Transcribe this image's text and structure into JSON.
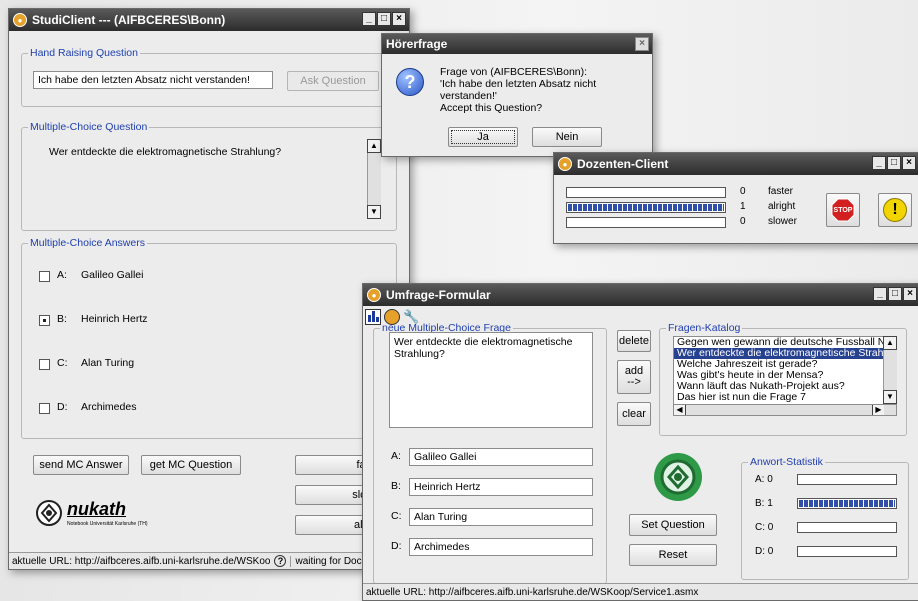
{
  "student": {
    "title": "StudiClient --- (AIFBCERES\\Bonn)",
    "hand_raising": {
      "legend": "Hand Raising Question",
      "question_value": "Ich habe den letzten Absatz nicht verstanden!",
      "ask_button": "Ask Question"
    },
    "mc_question": {
      "legend": "Multiple-Choice Question",
      "text": "Wer entdeckte die elektromagnetische Strahlung?"
    },
    "mc_answers": {
      "legend": "Multiple-Choice Answers",
      "items": [
        {
          "letter": "A:",
          "label": "Galileo Gallei",
          "checked": false
        },
        {
          "letter": "B:",
          "label": "Heinrich Hertz",
          "checked": true
        },
        {
          "letter": "C:",
          "label": "Alan Turing",
          "checked": false
        },
        {
          "letter": "D:",
          "label": "Archimedes",
          "checked": false
        }
      ]
    },
    "buttons": {
      "send": "send MC Answer",
      "get": "get MC Question",
      "faster": "faster",
      "slower": "slower",
      "alright": "alright"
    },
    "logo_text": "nukath",
    "logo_sub": "Notebook Universität Karlsruhe (TH)",
    "status_url": "aktuelle URL: http://aifbceres.aifb.uni-karlsruhe.de/WSKoo",
    "status_wait": "waiting for Doce"
  },
  "hoerfrage": {
    "title": "Hörerfrage",
    "line1": "Frage von (AIFBCERES\\Bonn):",
    "line2": "'Ich habe den letzten Absatz nicht verstanden!'",
    "accept": "Accept this Question?",
    "yes": "Ja",
    "no": "Nein"
  },
  "dozent": {
    "title": "Dozenten-Client",
    "rows": [
      {
        "count": "0",
        "label": "faster",
        "fill": 0.0
      },
      {
        "count": "1",
        "label": "alright",
        "fill": 1.0
      },
      {
        "count": "0",
        "label": "slower",
        "fill": 0.0
      }
    ],
    "stop_label": "STOP"
  },
  "umfrage": {
    "title": "Umfrage-Formular",
    "new_q": {
      "legend": "neue Multiple-Choice Frage",
      "question": "Wer entdeckte die elektromagnetische Strahlung?",
      "answers": [
        {
          "letter": "A:",
          "value": "Galileo Gallei"
        },
        {
          "letter": "B:",
          "value": "Heinrich Hertz"
        },
        {
          "letter": "C:",
          "value": "Alan Turing"
        },
        {
          "letter": "D:",
          "value": "Archimedes"
        }
      ]
    },
    "buttons": {
      "delete": "delete",
      "add": "add",
      "add_arrow": "-->",
      "clear": "clear",
      "set_question": "Set Question",
      "reset": "Reset"
    },
    "katalog": {
      "legend": "Fragen-Katalog",
      "items": [
        "Gegen wen gewann die deutsche Fussball Natio",
        "Wer entdeckte die elektromagnetische Strahlung",
        "Welche Jahreszeit ist gerade?",
        "Was gibt's heute in der Mensa?",
        "Wann läuft das Nukath-Projekt aus?",
        "Das hier ist nun die Frage 7"
      ],
      "selected_index": 1
    },
    "statistik": {
      "legend": "Anwort-Statistik",
      "rows": [
        {
          "label": "A: 0",
          "fill": 0.0
        },
        {
          "label": "B: 1",
          "fill": 1.0
        },
        {
          "label": "C: 0",
          "fill": 0.0
        },
        {
          "label": "D: 0",
          "fill": 0.0
        }
      ]
    },
    "status_url": "aktuelle URL: http://aifbceres.aifb.uni-karlsruhe.de/WSKoop/Service1.asmx"
  }
}
